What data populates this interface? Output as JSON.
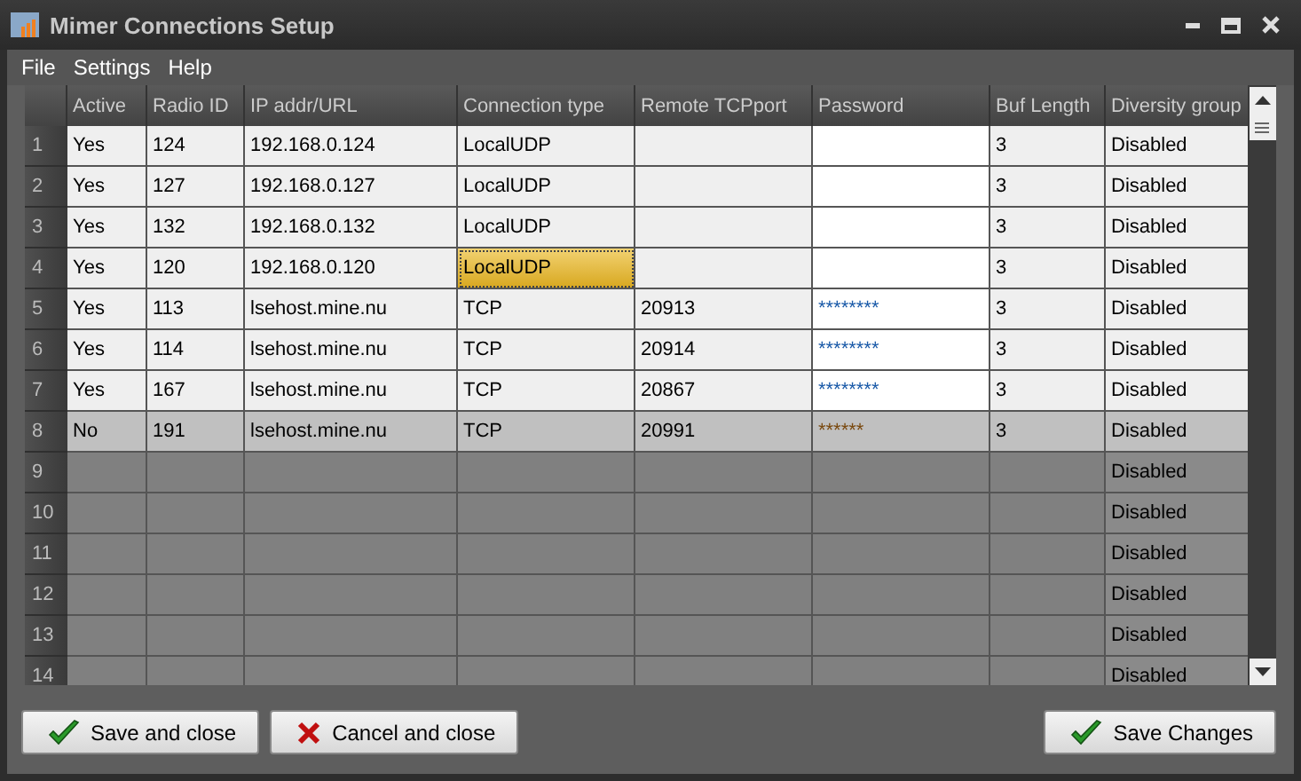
{
  "window": {
    "title": "Mimer Connections Setup"
  },
  "menu": [
    "File",
    "Settings",
    "Help"
  ],
  "table": {
    "columns": [
      "Active",
      "Radio ID",
      "IP addr/URL",
      "Connection type",
      "Remote TCPport",
      "Password",
      "Buf Length",
      "Diversity group"
    ],
    "rows": [
      {
        "number": "1",
        "kind": "entry",
        "dimmed": false,
        "focused": false,
        "active": "Yes",
        "radio_id": "124",
        "ip": "192.168.0.124",
        "connection_type": "LocalUDP",
        "buf_length": "3",
        "diversity_group": "Disabled"
      },
      {
        "number": "2",
        "kind": "entry",
        "dimmed": false,
        "focused": false,
        "active": "Yes",
        "radio_id": "127",
        "ip": "192.168.0.127",
        "connection_type": "LocalUDP",
        "buf_length": "3",
        "diversity_group": "Disabled"
      },
      {
        "number": "3",
        "kind": "entry",
        "dimmed": false,
        "focused": false,
        "active": "Yes",
        "radio_id": "132",
        "ip": "192.168.0.132",
        "connection_type": "LocalUDP",
        "buf_length": "3",
        "diversity_group": "Disabled"
      },
      {
        "number": "4",
        "kind": "entry",
        "dimmed": false,
        "focused": true,
        "active": "Yes",
        "radio_id": "120",
        "ip": "192.168.0.120",
        "connection_type": "LocalUDP",
        "buf_length": "3",
        "diversity_group": "Disabled"
      },
      {
        "number": "5",
        "kind": "entry",
        "dimmed": false,
        "focused": false,
        "active": "Yes",
        "radio_id": "113",
        "ip": "lsehost.mine.nu",
        "connection_type": "TCP",
        "remote_port": "20913",
        "password": "********",
        "buf_length": "3",
        "diversity_group": "Disabled"
      },
      {
        "number": "6",
        "kind": "entry",
        "dimmed": false,
        "focused": false,
        "active": "Yes",
        "radio_id": "114",
        "ip": "lsehost.mine.nu",
        "connection_type": "TCP",
        "remote_port": "20914",
        "password": "********",
        "buf_length": "3",
        "diversity_group": "Disabled"
      },
      {
        "number": "7",
        "kind": "entry",
        "dimmed": false,
        "focused": false,
        "active": "Yes",
        "radio_id": "167",
        "ip": "lsehost.mine.nu",
        "connection_type": "TCP",
        "remote_port": "20867",
        "password": "********",
        "buf_length": "3",
        "diversity_group": "Disabled"
      },
      {
        "number": "8",
        "kind": "entry",
        "dimmed": true,
        "focused": false,
        "active": "No",
        "radio_id": "191",
        "ip": "lsehost.mine.nu",
        "connection_type": "TCP",
        "remote_port": "20991",
        "password": "******",
        "buf_length": "3",
        "diversity_group": "Disabled"
      },
      {
        "number": "9",
        "kind": "blank",
        "diversity_group": "Disabled"
      },
      {
        "number": "10",
        "kind": "blank",
        "diversity_group": "Disabled"
      },
      {
        "number": "11",
        "kind": "blank",
        "diversity_group": "Disabled"
      },
      {
        "number": "12",
        "kind": "blank",
        "diversity_group": "Disabled"
      },
      {
        "number": "13",
        "kind": "blank",
        "diversity_group": "Disabled"
      },
      {
        "number": "14",
        "kind": "blank",
        "diversity_group": "Disabled"
      }
    ]
  },
  "buttons": [
    {
      "label": "Save and close",
      "kind": "save"
    },
    {
      "label": "Cancel and close",
      "kind": "cancel"
    },
    {
      "label": "Save Changes",
      "kind": "apply"
    }
  ]
}
